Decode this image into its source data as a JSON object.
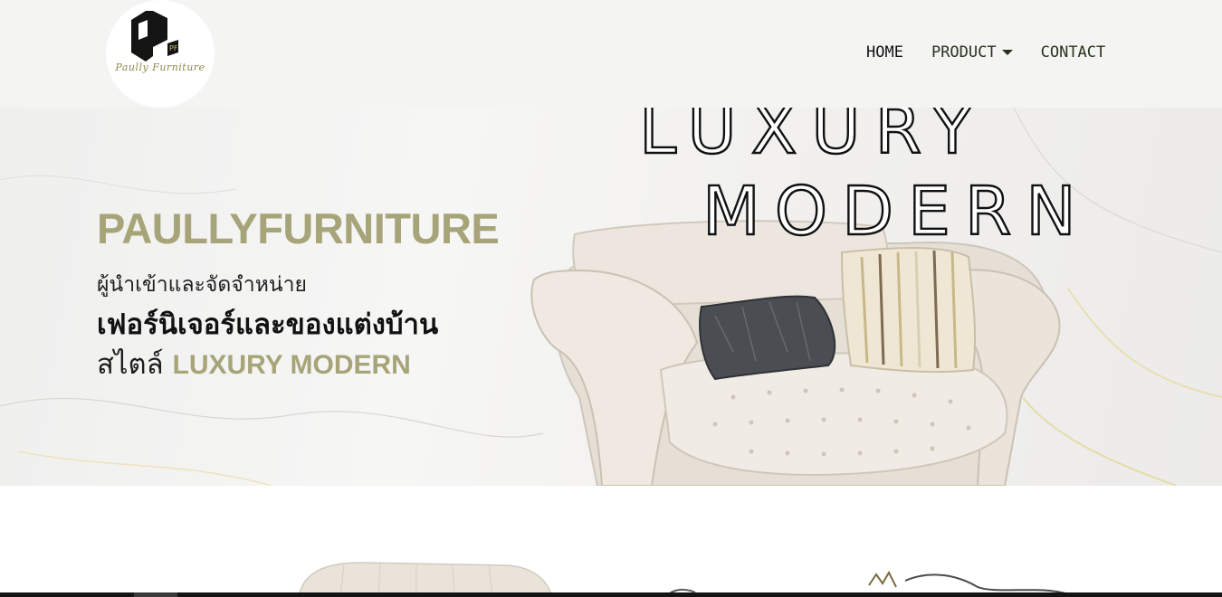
{
  "header": {
    "logo": {
      "icon": "pf-monogram-logo",
      "text": "Paully Furniture"
    },
    "nav": {
      "home": "HOME",
      "product": "PRODUCT",
      "contact": "CONTACT"
    }
  },
  "hero": {
    "brand": "PAULLYFURNITURE",
    "line1": "ผู้นำเข้าและจัดจำหน่าย",
    "line2": "เฟอร์นิเจอร์และของแต่งบ้าน",
    "line3_prefix": "สไตล์",
    "line3_accent": "LUXURY MODERN",
    "outline_word1": "LUXURY",
    "outline_word2": "MODERN"
  },
  "colors": {
    "accent": "#a6a478",
    "header_bg": "#f4f4f3",
    "text_dark": "#111111"
  }
}
